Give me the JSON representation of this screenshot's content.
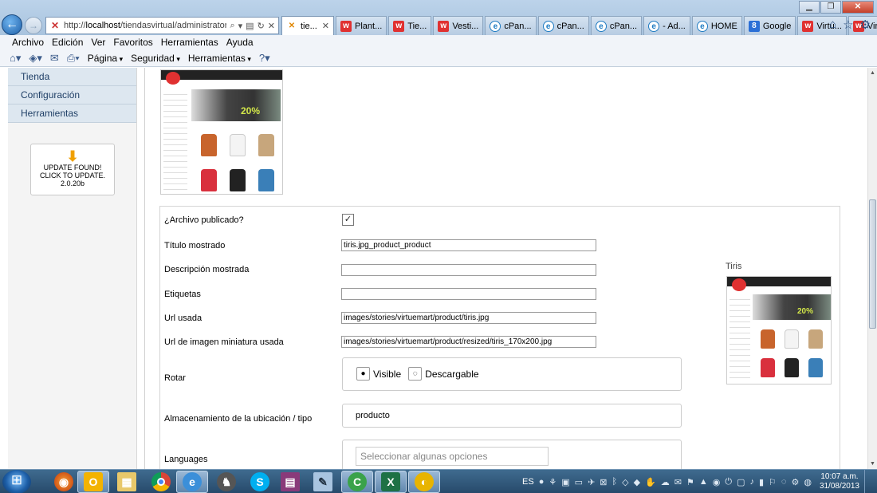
{
  "browser": {
    "url_prefix": "http://",
    "url_host": "localhost",
    "url_rest": "/tiendasvirtual/administrator/inc",
    "tabs": [
      {
        "label": "tie...",
        "icon": "joomla-icon",
        "glyph": "✕",
        "kind": "j",
        "active": true
      },
      {
        "label": "Plant...",
        "icon": "w-icon",
        "glyph": "w",
        "kind": "w"
      },
      {
        "label": "Tie...",
        "icon": "w-icon",
        "glyph": "w",
        "kind": "w"
      },
      {
        "label": "Vesti...",
        "icon": "w-icon",
        "glyph": "w",
        "kind": "w"
      },
      {
        "label": "cPan...",
        "icon": "cpanel-icon",
        "glyph": "e",
        "kind": "c"
      },
      {
        "label": "cPan...",
        "icon": "cpanel-icon",
        "glyph": "e",
        "kind": "c"
      },
      {
        "label": "cPan...",
        "icon": "cpanel-icon",
        "glyph": "e",
        "kind": "c"
      },
      {
        "label": "- Ad...",
        "icon": "cpanel-icon",
        "glyph": "e",
        "kind": "c"
      },
      {
        "label": "HOME",
        "icon": "cpanel-icon",
        "glyph": "e",
        "kind": "c"
      },
      {
        "label": "Google",
        "icon": "google-icon",
        "glyph": "8",
        "kind": "g"
      },
      {
        "label": "Virtu...",
        "icon": "w-icon",
        "glyph": "w",
        "kind": "w"
      },
      {
        "label": "Virtu...",
        "icon": "w-icon",
        "glyph": "w",
        "kind": "w"
      }
    ],
    "menu": [
      "Archivo",
      "Edición",
      "Ver",
      "Favoritos",
      "Herramientas",
      "Ayuda"
    ],
    "command_bar": {
      "page": "Página",
      "security": "Seguridad",
      "tools": "Herramientas"
    }
  },
  "sidebar": {
    "items": [
      "Tienda",
      "Configuración",
      "Herramientas"
    ],
    "update": {
      "line1": "UPDATE FOUND!",
      "line2": "CLICK TO UPDATE.",
      "line3": "2.0.20b"
    }
  },
  "thumbnail": {
    "discount": "20%"
  },
  "form": {
    "published_label": "¿Archivo publicado?",
    "published_checked": true,
    "title_label": "Título mostrado",
    "title_value": "tiris.jpg_product_product",
    "description_label": "Descripción mostrada",
    "description_value": "",
    "tags_label": "Etiquetas",
    "tags_value": "",
    "url_label": "Url usada",
    "url_value": "images/stories/virtuemart/product/tiris.jpg",
    "thumb_url_label": "Url de imagen miniatura usada",
    "thumb_url_value": "images/stories/virtuemart/product/resized/tiris_170x200.jpg",
    "rotate_label": "Rotar",
    "rotate_options": [
      "Visible",
      "Descargable"
    ],
    "rotate_selected": "Visible",
    "storage_label": "Almacenamiento de la ubicación / tipo",
    "storage_value": "producto",
    "languages_label": "Languages",
    "languages_placeholder": "Seleccionar algunas opciones"
  },
  "preview": {
    "label": "Tiris"
  },
  "taskbar": {
    "lang": "ES",
    "time": "10:07 a.m.",
    "date": "31/08/2013"
  },
  "colors": {
    "sidebar_item_bg": "#dde7f0",
    "sidebar_text": "#1f3f66",
    "taskbar": "#274a6b"
  }
}
